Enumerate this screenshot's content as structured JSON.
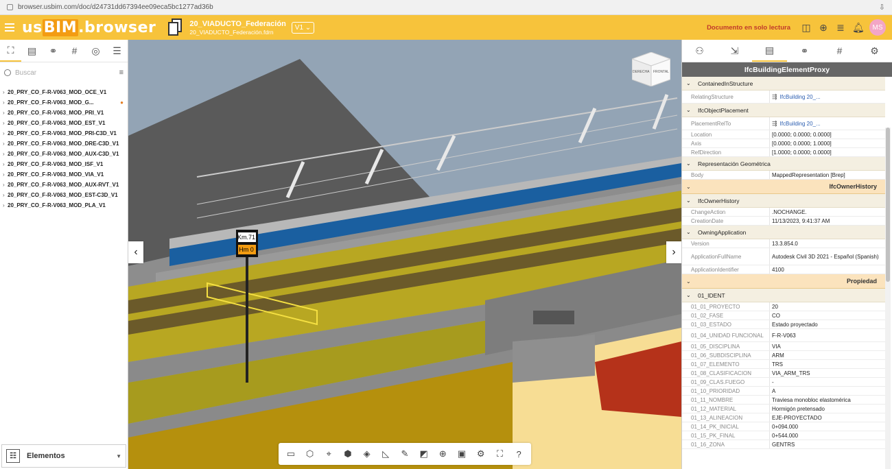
{
  "browser": {
    "url": "browser.usbim.com/doc/d24731dd67394ee09eca5bc1277ad36b"
  },
  "header": {
    "logo_us": "us",
    "logo_bim": "BIM",
    "logo_browser": ".browser",
    "doc_title": "20_VIADUCTO_Federación",
    "doc_file": "20_VIADUCTO_Federación.fdrn",
    "version": "V1",
    "status": "Documento en solo lectura",
    "avatar": "MS"
  },
  "left": {
    "search_placeholder": "Buscar",
    "items": [
      "20_PRY_CO_F-R-V063_MOD_OCE_V1",
      "20_PRY_CO_F-R-V063_MOD_G...",
      "20_PRY_CO_F-R-V063_MOD_PRI_V1",
      "20_PRY_CO_F-R-V063_MOD_EST_V1",
      "20_PRY_CO_F-R-V063_MOD_PRI-C3D_V1",
      "20_PRY_CO_F-R-V063_MOD_DRE-C3D_V1",
      "20_PRY_CO_F-R-V063_MOD_AUX-C3D_V1",
      "20_PRY_CO_F-R-V063_MOD_ISF_V1",
      "20_PRY_CO_F-R-V063_MOD_VIA_V1",
      "20_PRY_CO_F-R-V063_MOD_AUX-RVT_V1",
      "20_PRY_CO_F-R-V063_MOD_EST-C3D_V1",
      "20_PRY_CO_F-R-V063_MOD_PLA_V1"
    ],
    "elementos_label": "Elementos"
  },
  "viewport": {
    "sign_top": "Km.71",
    "sign_bottom": "Hm 0",
    "cube_left": "DERECHA",
    "cube_right": "FRONTAL"
  },
  "right": {
    "title": "IfcBuildingElementProxy",
    "sections": {
      "contained": "ContainedInStructure",
      "placement": "IfcObjectPlacement",
      "repr": "Representación Geométrica",
      "owner_group": "IfcOwnerHistory",
      "owner": "IfcOwnerHistory",
      "owning_app": "OwningApplication",
      "prop_group": "Propiedad",
      "ident": "01_IDENT"
    },
    "contained_rows": [
      {
        "k": "RelatingStructure",
        "v": "IfcBuilding 20_..."
      }
    ],
    "placement_rows": [
      {
        "k": "PlacementRelTo",
        "v": "IfcBuilding 20_..."
      },
      {
        "k": "Location",
        "v": "[0.0000; 0.0000; 0.0000]"
      },
      {
        "k": "Axis",
        "v": "[0.0000; 0.0000; 1.0000]"
      },
      {
        "k": "RefDirection",
        "v": "[1.0000; 0.0000; 0.0000]"
      }
    ],
    "repr_rows": [
      {
        "k": "Body",
        "v": "MappedRepresentation [Brep]"
      }
    ],
    "owner_rows": [
      {
        "k": "ChangeAction",
        "v": ".NOCHANGE."
      },
      {
        "k": "CreationDate",
        "v": "11/13/2023, 9:41:37 AM"
      }
    ],
    "app_rows": [
      {
        "k": "Version",
        "v": "13.3.854.0"
      },
      {
        "k": "ApplicationFullName",
        "v": "Autodesk Civil 3D 2021 - Español (Spanish)"
      },
      {
        "k": "ApplicationIdentifier",
        "v": "4100"
      }
    ],
    "ident_rows": [
      {
        "k": "01_01_PROYECTO",
        "v": "20"
      },
      {
        "k": "01_02_FASE",
        "v": "CO"
      },
      {
        "k": "01_03_ESTADO",
        "v": "Estado proyectado"
      },
      {
        "k": "01_04_UNIDAD FUNCIONAL",
        "v": "F-R-V063"
      },
      {
        "k": "01_05_DISCIPLINA",
        "v": "VIA"
      },
      {
        "k": "01_06_SUBDISCIPLINA",
        "v": "ARM"
      },
      {
        "k": "01_07_ELEMENTO",
        "v": "TRS"
      },
      {
        "k": "01_08_CLASIFICACION",
        "v": "VIA_ARM_TRS"
      },
      {
        "k": "01_09_CLAS.FUEGO",
        "v": "-"
      },
      {
        "k": "01_10_PRIORIDAD",
        "v": "A"
      },
      {
        "k": "01_11_NOMBRE",
        "v": "Traviesa monobloc elastomérica"
      },
      {
        "k": "01_12_MATERIAL",
        "v": "Hormigón pretensado"
      },
      {
        "k": "01_13_ALINEACION",
        "v": "EJE-PROYECTADO"
      },
      {
        "k": "01_14_PK_INICIAL",
        "v": "0+094.000"
      },
      {
        "k": "01_15_PK_FINAL",
        "v": "0+544.000"
      },
      {
        "k": "01_16_ZONA",
        "v": "GENTRS"
      }
    ]
  },
  "colors": {
    "accent": "#f7c33b",
    "readonly": "#c0392b",
    "link": "#2a5db0"
  }
}
